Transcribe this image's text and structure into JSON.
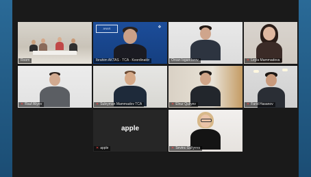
{
  "meeting": {
    "participants": [
      {
        "name": "Room",
        "muted": false
      },
      {
        "name": "Ibrahim AKTAS - TCA - Koordinatör",
        "muted": false
      },
      {
        "name": "Orxan Isgandarov",
        "muted": false
      },
      {
        "name": "Leyla Mammadova",
        "muted": true
      },
      {
        "name": "Rauf Aliyev",
        "muted": true
      },
      {
        "name": "Suleyman Mammadov TCA",
        "muted": true
      },
      {
        "name": "Elnur Quliyev",
        "muted": true
      },
      {
        "name": "Farid Hasanov",
        "muted": true
      },
      {
        "name": "apple",
        "muted": true
      },
      {
        "name": "Sevinc Guliyeva",
        "muted": true
      }
    ],
    "apple_tile_label": "apple",
    "active_speaker_index": 5,
    "colors": {
      "active_border": "#b5e07a",
      "muted_icon": "#ff4a4a",
      "background": "#1a1a1a",
      "desktop": "#1f5a86"
    },
    "tile_logo_text": "ANAS",
    "mute_icon": "microphone-muted-icon"
  }
}
